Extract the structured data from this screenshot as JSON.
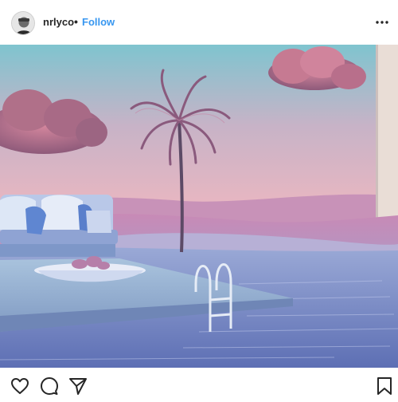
{
  "post": {
    "username": "nrlyco",
    "separator": "•",
    "follow_label": "Follow"
  },
  "icons": {
    "more": "more-options-icon",
    "like": "heart-icon",
    "comment": "comment-icon",
    "share": "share-icon",
    "save": "bookmark-icon"
  },
  "colors": {
    "follow": "#3897f0",
    "text": "#262626"
  }
}
